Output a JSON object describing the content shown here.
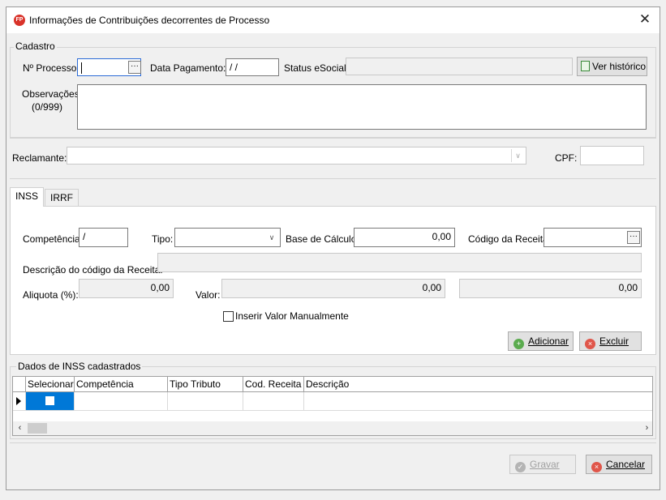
{
  "window": {
    "app_icon_text": "FP",
    "title": "Informações de Contribuições decorrentes de Processo",
    "close_glyph": "✕"
  },
  "cadastro": {
    "caption": "Cadastro",
    "processo_label": "Nº Processo:",
    "processo_value": "",
    "data_pagamento_label": "Data Pagamento:",
    "data_pagamento_value": " / /",
    "status_esocial_label": "Status eSocial:",
    "status_esocial_value": "",
    "ver_historico_label": "Ver histórico",
    "observacoes_label": "Observações:",
    "observacoes_counter": "(0/999)",
    "observacoes_value": ""
  },
  "reclamante": {
    "label": "Reclamante:",
    "value": "",
    "cpf_label": "CPF:",
    "cpf_value": ""
  },
  "tabs": [
    {
      "label": "INSS",
      "active": true
    },
    {
      "label": "IRRF",
      "active": false
    }
  ],
  "inss": {
    "competencia_label": "Competência:",
    "competencia_value": " /",
    "tipo_label": "Tipo:",
    "tipo_value": "",
    "base_calculo_label": "Base de Cálculo:",
    "base_calculo_value": "0,00",
    "codigo_receita_label": "Código da Receita:",
    "codigo_receita_value": "",
    "descricao_codigo_label": "Descrição do código da Receita:",
    "descricao_codigo_value": "",
    "aliquota_label": "Aliquota (%):",
    "aliquota_value": "0,00",
    "valor_label": "Valor:",
    "valor_value": "0,00",
    "valor_extra_value": "0,00",
    "inserir_manual_label": "Inserir Valor Manualmente",
    "adicionar_label": "Adicionar",
    "excluir_label": "Excluir"
  },
  "grid": {
    "caption": "Dados de INSS cadastrados",
    "columns": [
      "Selecionar",
      "Competência",
      "Tipo Tributo",
      "Cod. Receita",
      "Descrição"
    ]
  },
  "footer": {
    "gravar_label": "Gravar",
    "cancelar_label": "Cancelar"
  },
  "colors": {
    "selection_blue": "#0078d7",
    "accent_red": "#e0564a",
    "accent_green": "#5aab4e"
  }
}
